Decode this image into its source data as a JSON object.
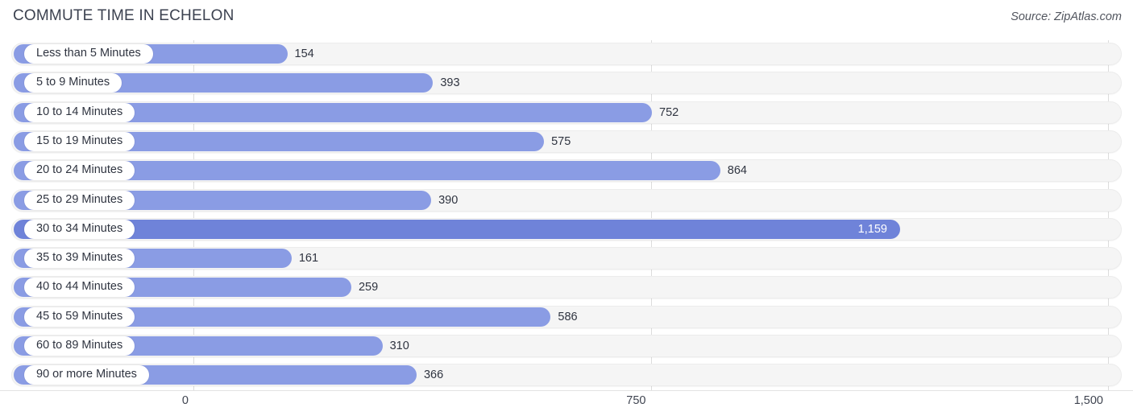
{
  "header": {
    "title": "COMMUTE TIME IN ECHELON",
    "source": "Source: ZipAtlas.com"
  },
  "axis": {
    "ticks": [
      {
        "label": "0",
        "value": 0
      },
      {
        "label": "750",
        "value": 750
      },
      {
        "label": "1,500",
        "value": 1500
      }
    ]
  },
  "colors": {
    "bar": "#8a9ce4",
    "bar_highlight": "#6f83d9",
    "track": "#f5f5f5",
    "grid": "#dcdcdc",
    "title_text": "#3c4250"
  },
  "chart_data": {
    "type": "bar",
    "orientation": "horizontal",
    "title": "COMMUTE TIME IN ECHELON",
    "xlabel": "",
    "ylabel": "",
    "xlim": [
      0,
      1500
    ],
    "grid": true,
    "legend": "none",
    "categories": [
      "Less than 5 Minutes",
      "5 to 9 Minutes",
      "10 to 14 Minutes",
      "15 to 19 Minutes",
      "20 to 24 Minutes",
      "25 to 29 Minutes",
      "30 to 34 Minutes",
      "35 to 39 Minutes",
      "40 to 44 Minutes",
      "45 to 59 Minutes",
      "60 to 89 Minutes",
      "90 or more Minutes"
    ],
    "values": [
      154,
      393,
      752,
      575,
      864,
      390,
      1159,
      161,
      259,
      586,
      310,
      366
    ],
    "value_labels": [
      "154",
      "393",
      "752",
      "575",
      "864",
      "390",
      "1,159",
      "161",
      "259",
      "586",
      "310",
      "366"
    ],
    "highlight_index": 6,
    "xticks": [
      0,
      750,
      1500
    ],
    "xticklabels": [
      "0",
      "750",
      "1,500"
    ]
  }
}
